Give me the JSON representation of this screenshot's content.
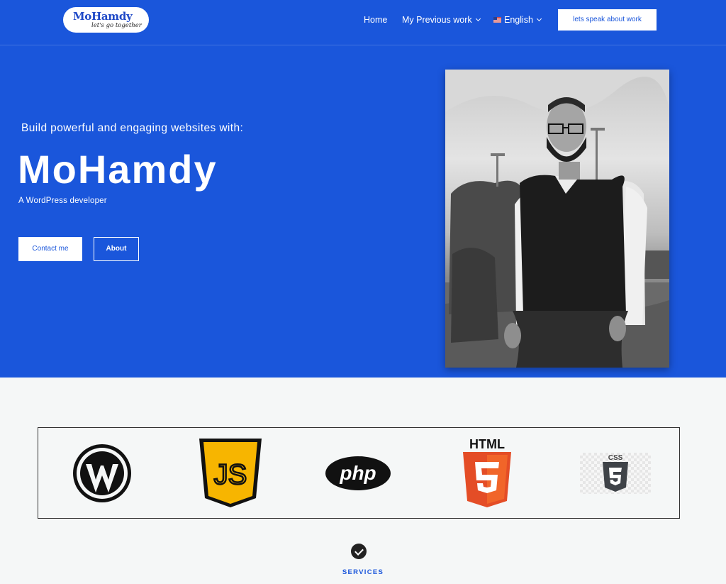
{
  "header": {
    "logo": {
      "name": "MoHamdy",
      "tagline": "let's go together"
    },
    "nav": {
      "home": "Home",
      "previous_work": "My Previous work",
      "language": "English"
    },
    "cta": "lets speak about work"
  },
  "hero": {
    "subtitle": "Build powerful and engaging websites with:",
    "title": "MoHamdy",
    "role": "A WordPress developer",
    "contact_button": "Contact me",
    "about_button": "About"
  },
  "tech_logos": [
    {
      "icon": "wordpress-logo-icon"
    },
    {
      "icon": "javascript-logo-icon",
      "text": "JS"
    },
    {
      "icon": "php-logo-icon",
      "text": "php"
    },
    {
      "icon": "html5-logo-icon",
      "text": "HTML"
    },
    {
      "icon": "css3-logo-icon",
      "text": "CSS"
    }
  ],
  "services": {
    "label": "SERVICES"
  },
  "colors": {
    "brand_blue": "#1a56db",
    "section_bg": "#f5f7f7"
  }
}
